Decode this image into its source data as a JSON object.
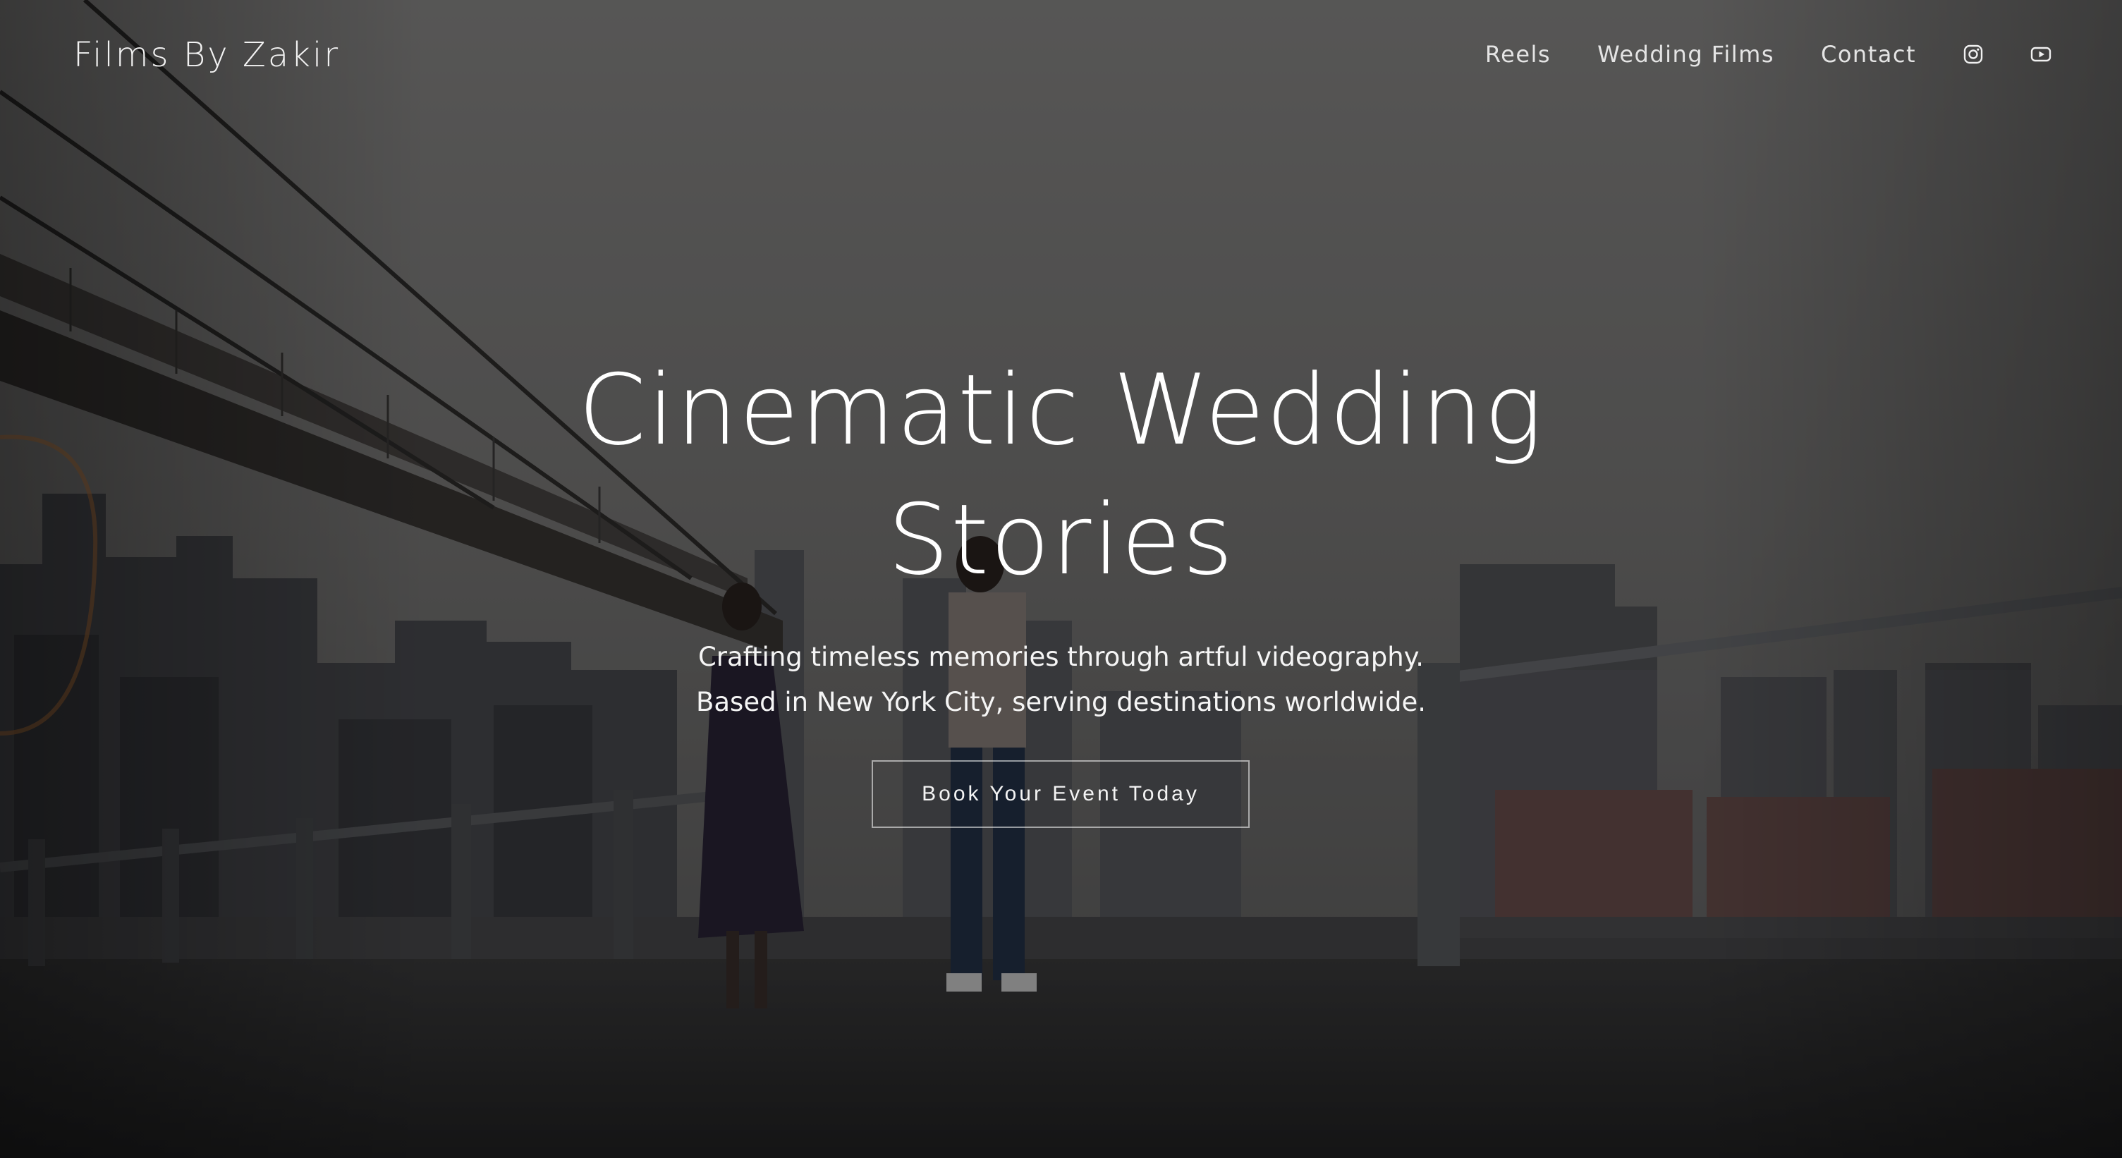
{
  "header": {
    "site_title": "Films By Zakir",
    "nav": {
      "reels": "Reels",
      "wedding_films": "Wedding Films",
      "contact": "Contact"
    },
    "social_icons": [
      "instagram-icon",
      "youtube-icon"
    ]
  },
  "hero": {
    "title_line1": "Cinematic Wedding",
    "title_line2": "Stories",
    "subtitle_line1": "Crafting timeless memories through artful videography.",
    "subtitle_line2": "Based in New York City, serving destinations worldwide.",
    "cta_label": "Book Your Event Today"
  },
  "colors": {
    "text": "#ffffff",
    "overlay": "#000000",
    "sky": "#6a6968",
    "ground": "#2a2a2a"
  }
}
